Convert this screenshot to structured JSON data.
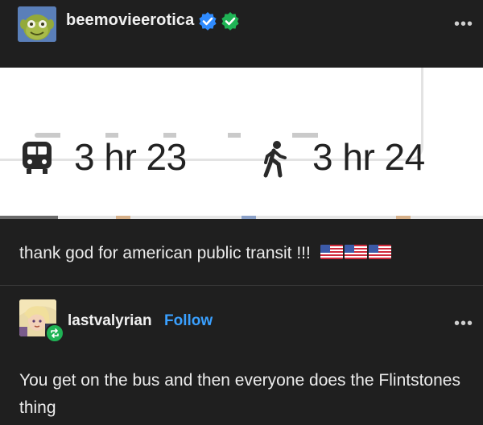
{
  "post": {
    "author": "beemovieerotica",
    "badges": [
      "verified-blue-badge",
      "verified-green-badge"
    ],
    "menu": "•••",
    "embed": {
      "transit_time": "3 hr 23",
      "walk_time": "3 hr 24",
      "transit_icon": "train-icon",
      "walk_icon": "walking-person-icon"
    },
    "caption": "thank god for american public transit !!!",
    "caption_emoji": [
      "us-flag",
      "us-flag",
      "us-flag"
    ]
  },
  "reblog": {
    "author": "lastvalyrian",
    "follow_label": "Follow",
    "menu": "•••",
    "text": "You get on the bus and then everyone does the Flintstones thing"
  },
  "colors": {
    "background": "#1f1f1f",
    "text": "#ececec",
    "follow": "#3aa0ff",
    "reblog_badge": "#1fb355",
    "verified_blue": "#2f8bff",
    "verified_green": "#1fb355"
  }
}
